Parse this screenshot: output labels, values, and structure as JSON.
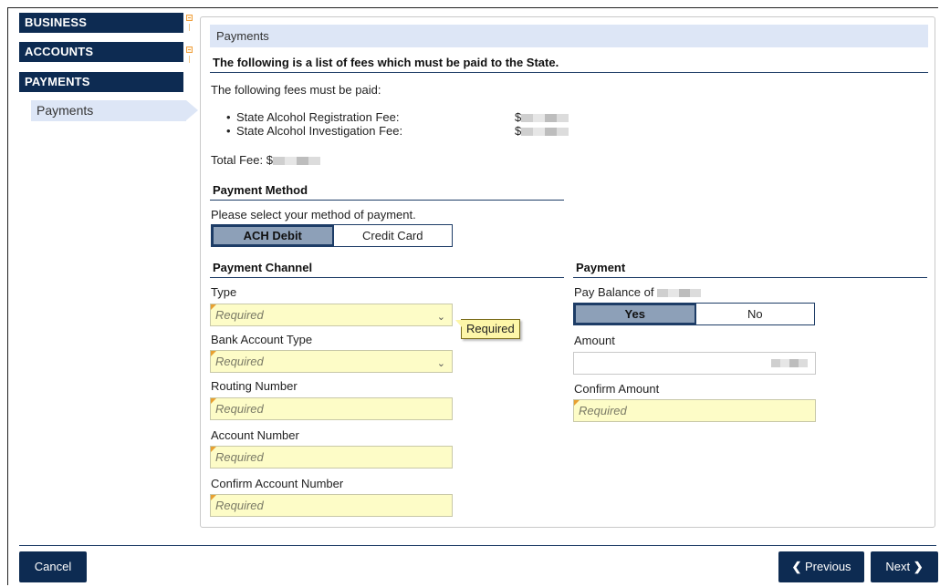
{
  "sidebar": {
    "business": "BUSINESS",
    "accounts": "ACCOUNTS",
    "payments": "PAYMENTS",
    "payments_sub": "Payments"
  },
  "panel": {
    "title": "Payments",
    "fees_header": "The following is a list of fees which must be paid to the State.",
    "fees_intro": "The following fees must be paid:",
    "fees": [
      {
        "label": "State Alcohol Registration Fee:",
        "amount_prefix": "$"
      },
      {
        "label": "State Alcohol Investigation Fee:",
        "amount_prefix": "$"
      }
    ],
    "total_label": "Total Fee: $"
  },
  "payment_method": {
    "header": "Payment Method",
    "prompt": "Please select your method of payment.",
    "options": [
      "ACH Debit",
      "Credit Card"
    ],
    "selected": "ACH Debit"
  },
  "payment_channel": {
    "header": "Payment Channel",
    "type_label": "Type",
    "type_placeholder": "Required",
    "bank_type_label": "Bank Account Type",
    "bank_type_placeholder": "Required",
    "routing_label": "Routing Number",
    "routing_placeholder": "Required",
    "account_label": "Account Number",
    "account_placeholder": "Required",
    "confirm_account_label": "Confirm Account Number",
    "confirm_account_placeholder": "Required",
    "tooltip": "Required"
  },
  "payment": {
    "header": "Payment",
    "pay_balance_label": "Pay Balance of",
    "options": [
      "Yes",
      "No"
    ],
    "selected": "Yes",
    "amount_label": "Amount",
    "confirm_amount_label": "Confirm Amount",
    "confirm_amount_placeholder": "Required"
  },
  "footer": {
    "cancel": "Cancel",
    "previous": "Previous",
    "next": "Next"
  }
}
